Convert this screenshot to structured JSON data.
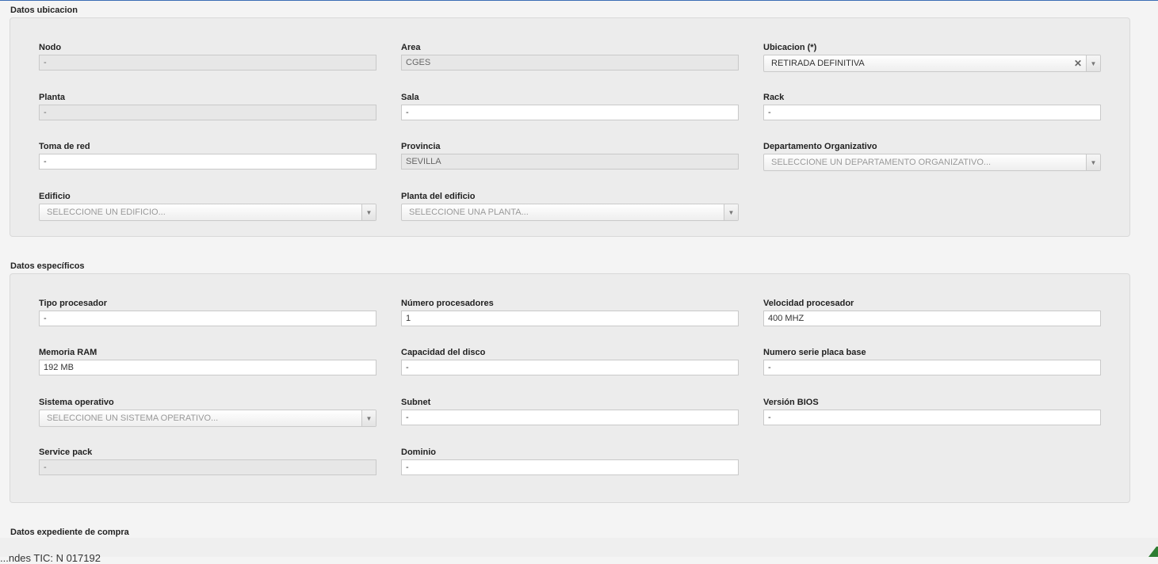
{
  "ubicacion": {
    "title": "Datos ubicacion",
    "nodo": {
      "label": "Nodo",
      "value": "-"
    },
    "area": {
      "label": "Area",
      "value": "CGES"
    },
    "ubicacion": {
      "label": "Ubicacion (*)",
      "value": "RETIRADA DEFINITIVA"
    },
    "planta": {
      "label": "Planta",
      "value": "-"
    },
    "sala": {
      "label": "Sala",
      "value": "-"
    },
    "rack": {
      "label": "Rack",
      "value": "-"
    },
    "toma_red": {
      "label": "Toma de red",
      "value": "-"
    },
    "provincia": {
      "label": "Provincia",
      "value": "SEVILLA"
    },
    "departamento": {
      "label": "Departamento Organizativo",
      "placeholder": "SELECCIONE UN DEPARTAMENTO ORGANIZATIVO..."
    },
    "edificio": {
      "label": "Edificio",
      "placeholder": "SELECCIONE UN EDIFICIO..."
    },
    "planta_edificio": {
      "label": "Planta del edificio",
      "placeholder": "SELECCIONE UNA PLANTA..."
    }
  },
  "especificos": {
    "title": "Datos específicos",
    "tipo_procesador": {
      "label": "Tipo procesador",
      "value": "-"
    },
    "numero_procesadores": {
      "label": "Número procesadores",
      "value": "1"
    },
    "velocidad_procesador": {
      "label": "Velocidad procesador",
      "value": "400 MHZ"
    },
    "memoria_ram": {
      "label": "Memoria RAM",
      "value": "192 MB"
    },
    "capacidad_disco": {
      "label": "Capacidad del disco",
      "value": "-"
    },
    "numero_serie_placa": {
      "label": "Numero serie placa base",
      "value": "-"
    },
    "sistema_operativo": {
      "label": "Sistema operativo",
      "placeholder": "SELECCIONE UN SISTEMA OPERATIVO..."
    },
    "subnet": {
      "label": "Subnet",
      "value": "-"
    },
    "version_bios": {
      "label": "Versión BIOS",
      "value": "-"
    },
    "service_pack": {
      "label": "Service pack",
      "value": "-"
    },
    "dominio": {
      "label": "Dominio",
      "value": "-"
    }
  },
  "expediente": {
    "title": "Datos expediente de compra"
  },
  "footer": {
    "text": "...ndes TIC: N 017192"
  },
  "colors": {
    "accent_line": "#3b6db5",
    "logo_green": "#2e7d32"
  }
}
